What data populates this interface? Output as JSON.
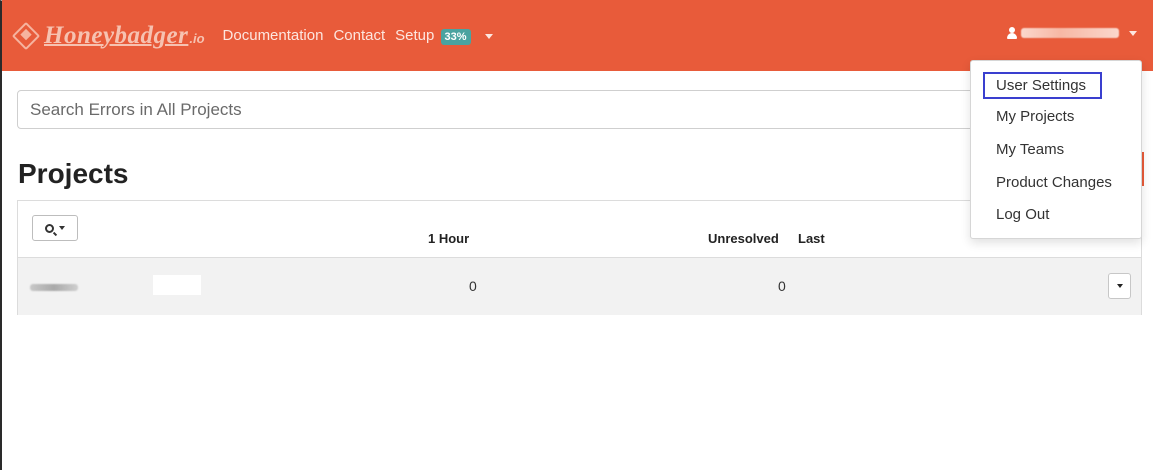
{
  "navbar": {
    "brand_name": "Honeybadger",
    "brand_tld": ".io",
    "links": [
      "Documentation",
      "Contact",
      "Setup"
    ],
    "setup_badge": "33%",
    "accent_color": "#e85b3a"
  },
  "search": {
    "placeholder": "Search Errors in All Projects"
  },
  "page": {
    "title": "Projects"
  },
  "table": {
    "columns": [
      "1 Hour",
      "Unresolved",
      "Last"
    ],
    "rows": [
      {
        "hour": "0",
        "unresolved": "0",
        "last": ""
      }
    ]
  },
  "user_menu": {
    "items": [
      "User Settings",
      "My Projects",
      "My Teams",
      "Product Changes",
      "Log Out"
    ]
  }
}
